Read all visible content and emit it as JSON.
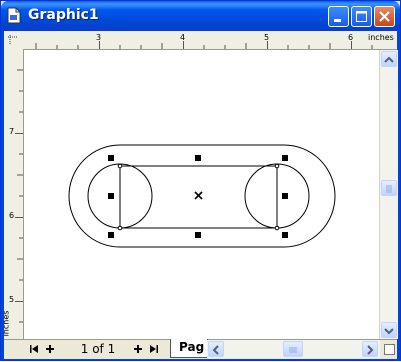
{
  "window": {
    "title": "Graphic1"
  },
  "ruler": {
    "unit_label": "inches",
    "top_ticks": [
      "3",
      "4",
      "5",
      "6"
    ],
    "left_ticks": [
      "7",
      "6",
      "5"
    ]
  },
  "pager": {
    "page_info": "1 of 1",
    "tab_label": "Pag"
  },
  "colors": {
    "titlebar": "#0058ee",
    "close_button": "#c9441c",
    "canvas": "#ffffff"
  }
}
